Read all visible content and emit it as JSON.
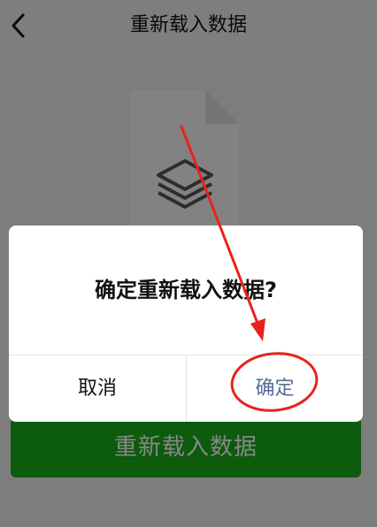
{
  "nav": {
    "title": "重新载入数据",
    "back_icon": "chevron-left-icon"
  },
  "main": {
    "illustration_icon": "document-layers-icon",
    "reload_button_label": "重新载入数据",
    "reload_button_color": "#1aad19"
  },
  "dialog": {
    "message": "确定重新载入数据?",
    "cancel_label": "取消",
    "confirm_label": "确定",
    "confirm_color": "#576b95"
  },
  "annotation": {
    "color": "#e8231b",
    "arrow_icon": "red-arrow-annotation",
    "circle_icon": "red-circle-annotation"
  }
}
